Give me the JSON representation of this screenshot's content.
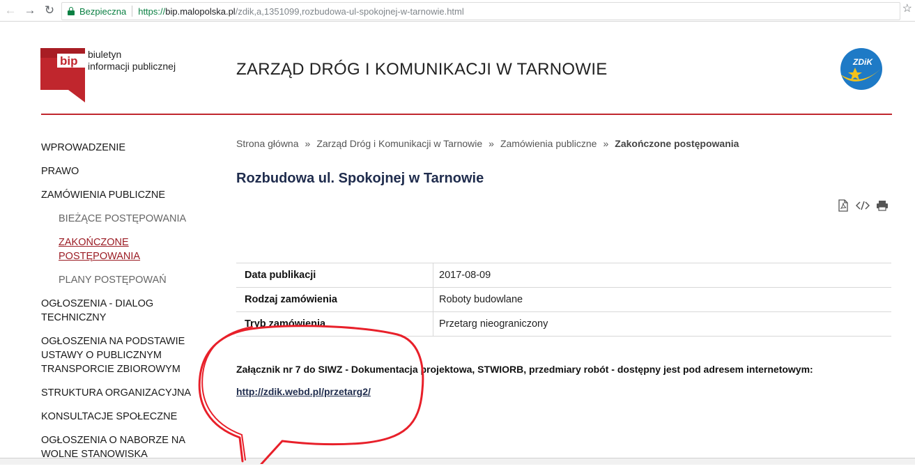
{
  "browser": {
    "secure_label": "Bezpieczna",
    "url_https": "https://",
    "url_host": "bip.malopolska.pl",
    "url_path": "/zdik,a,1351099,rozbudowa-ul-spokojnej-w-tarnowie.html"
  },
  "header": {
    "bip_line1": "biuletyn",
    "bip_line2": "informacji publicznej",
    "bip_mark": "bip",
    "site_title": "ZARZĄD DRÓG I KOMUNIKACJI W TARNOWIE",
    "zdik_mark": "ZDiK"
  },
  "sidebar": {
    "items": [
      {
        "label": "WPROWADZENIE"
      },
      {
        "label": "PRAWO"
      },
      {
        "label": "ZAMÓWIENIA PUBLICZNE"
      },
      {
        "label": "BIEŻĄCE POSTĘPOWANIA"
      },
      {
        "label": "ZAKOŃCZONE POSTĘPOWANIA"
      },
      {
        "label": "PLANY POSTĘPOWAŃ"
      },
      {
        "label": "OGŁOSZENIA - DIALOG TECHNICZNY"
      },
      {
        "label": "OGŁOSZENIA NA PODSTAWIE USTAWY O PUBLICZNYM TRANSPORCIE ZBIOROWYM"
      },
      {
        "label": "STRUKTURA ORGANIZACYJNA"
      },
      {
        "label": "KONSULTACJE SPOŁECZNE"
      },
      {
        "label": "OGŁOSZENIA O NABORZE NA WOLNE STANOWISKA"
      }
    ]
  },
  "breadcrumb": {
    "items": [
      "Strona główna",
      "Zarząd Dróg i Komunikacji w Tarnowie",
      "Zamówienia publiczne",
      "Zakończone postępowania"
    ],
    "separator": "»"
  },
  "article": {
    "title": "Rozbudowa ul. Spokojnej w Tarnowie",
    "meta": [
      {
        "key": "Data publikacji",
        "value": "2017-08-09"
      },
      {
        "key": "Rodzaj zamówienia",
        "value": "Roboty budowlane"
      },
      {
        "key": "Tryb zamówienia",
        "value": "Przetarg nieograniczony"
      }
    ],
    "note": "Załącznik nr 7 do SIWZ - Dokumentacja projektowa, STWIORB, przedmiary robót - dostępny jest pod adresem internetowym:",
    "link": "http://zdik.webd.pl/przetarg2/"
  },
  "colors": {
    "accent_red": "#c0262d",
    "title_navy": "#1f2c4d",
    "annotation_red": "#e8202a"
  }
}
